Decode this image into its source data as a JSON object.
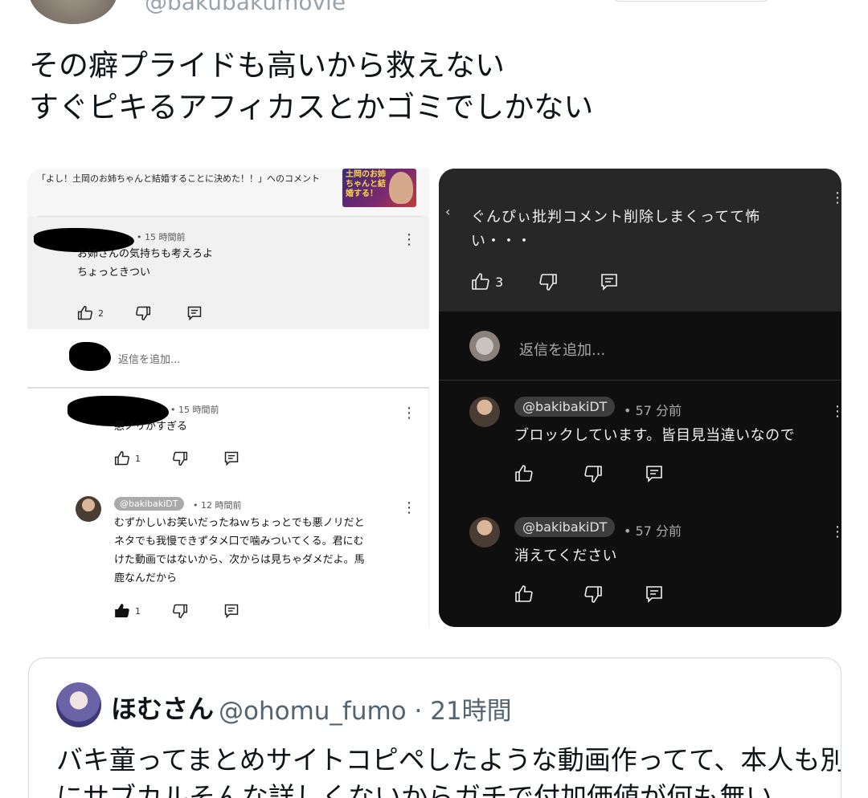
{
  "tweet": {
    "handle": "@bakubakumovie",
    "lines": [
      "その癖プライドも高いから救えない",
      "すぐピキるアフィカスとかゴミでしかない"
    ]
  },
  "left_panel": {
    "header": "「よし！土岡のお姉ちゃんと結婚することに決めた！！」へのコメント",
    "thumbnail_text": "土岡のお姉ちゃんと結婚する！",
    "comment1": {
      "time": "• 15 時間前",
      "lines": [
        "お姉さんの気持ちも考えろよ",
        "ちょっときつい"
      ],
      "likes": "2"
    },
    "reply_placeholder": "返信を追加...",
    "reply1": {
      "time": "• 15 時間前",
      "text": "悪ノリがすぎる",
      "likes": "1"
    },
    "reply2": {
      "handle": "@bakibakiDT",
      "time": "• 12 時間前",
      "lines": [
        "むずかしいお笑いだったねｗちょっとでも悪ノリだと",
        "ネタでも我慢できずタメ口で噛みついてくる。君にむ",
        "けた動画ではないから、次からは見ちゃダメだよ。馬",
        "鹿なんだから"
      ],
      "likes": "1"
    }
  },
  "right_panel": {
    "comment": {
      "lines": [
        "ぐんぴぃ批判コメント削除しまくってて怖",
        "い・・・"
      ],
      "likes": "3"
    },
    "reply_placeholder": "返信を追加...",
    "reply1": {
      "handle": "@bakibakiDT",
      "time": "• 57 分前",
      "text": "ブロックしています。皆目見当違いなので"
    },
    "reply2": {
      "handle": "@bakibakiDT",
      "time": "• 57 分前",
      "text": "消えてください"
    }
  },
  "quote": {
    "name": "ほむさん",
    "handle_time": "@ohomu_fumo · 21時間",
    "lines": [
      "バキ童ってまとめサイトコピペしたような動画作ってて、本人も別",
      "にサブカルそんな詳しくないからガチで付加価値が何も無い"
    ]
  }
}
